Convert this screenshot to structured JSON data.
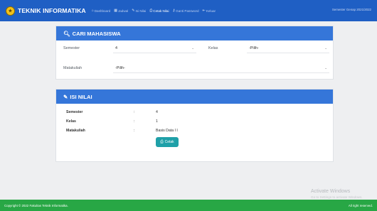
{
  "header": {
    "brand_title": "TEKNIK INFORMATIKA",
    "logo_icon": "university-seal-icon",
    "menu": [
      {
        "label": "Dashboard",
        "icon": "home-icon"
      },
      {
        "label": "Jadwal",
        "icon": "calendar-icon"
      },
      {
        "label": "Isi Nilai",
        "icon": "pencil-icon"
      },
      {
        "label": "Cetak Nilai",
        "icon": "print-icon"
      },
      {
        "label": "Ganti Password",
        "icon": "key-icon"
      },
      {
        "label": "Keluar",
        "icon": "sign-out-icon"
      }
    ],
    "semester_text": "Semester Genap 2021/2022"
  },
  "search_panel": {
    "title": "CARI MAHASISWA",
    "semester_label": "Semester",
    "semester_value": "4",
    "kelas_label": "Kelas",
    "kelas_value": "-Pilih-",
    "matakuliah_label": "Matakuliah",
    "matakuliah_value": "-Pilih-"
  },
  "grade_panel": {
    "title": "ISI NILAI",
    "rows": [
      {
        "label": "Semester",
        "colon": ":",
        "value": "4"
      },
      {
        "label": "Kelas",
        "colon": ":",
        "value": "1"
      },
      {
        "label": "Matakuliah",
        "colon": ":",
        "value": "Basis Data I I"
      }
    ],
    "print_button": "Cetak"
  },
  "watermark": {
    "line1": "Activate Windows",
    "line2": "Go to Settings to activate Windows."
  },
  "footer": {
    "copyright": "Copyright © 2022 Fakultas Teknik Informatika.",
    "rights": "All right reserved."
  },
  "colors": {
    "topbar": "#1f5fc4",
    "panel_header": "#3576d9",
    "button": "#1fa0a8",
    "footer": "#28a745"
  }
}
